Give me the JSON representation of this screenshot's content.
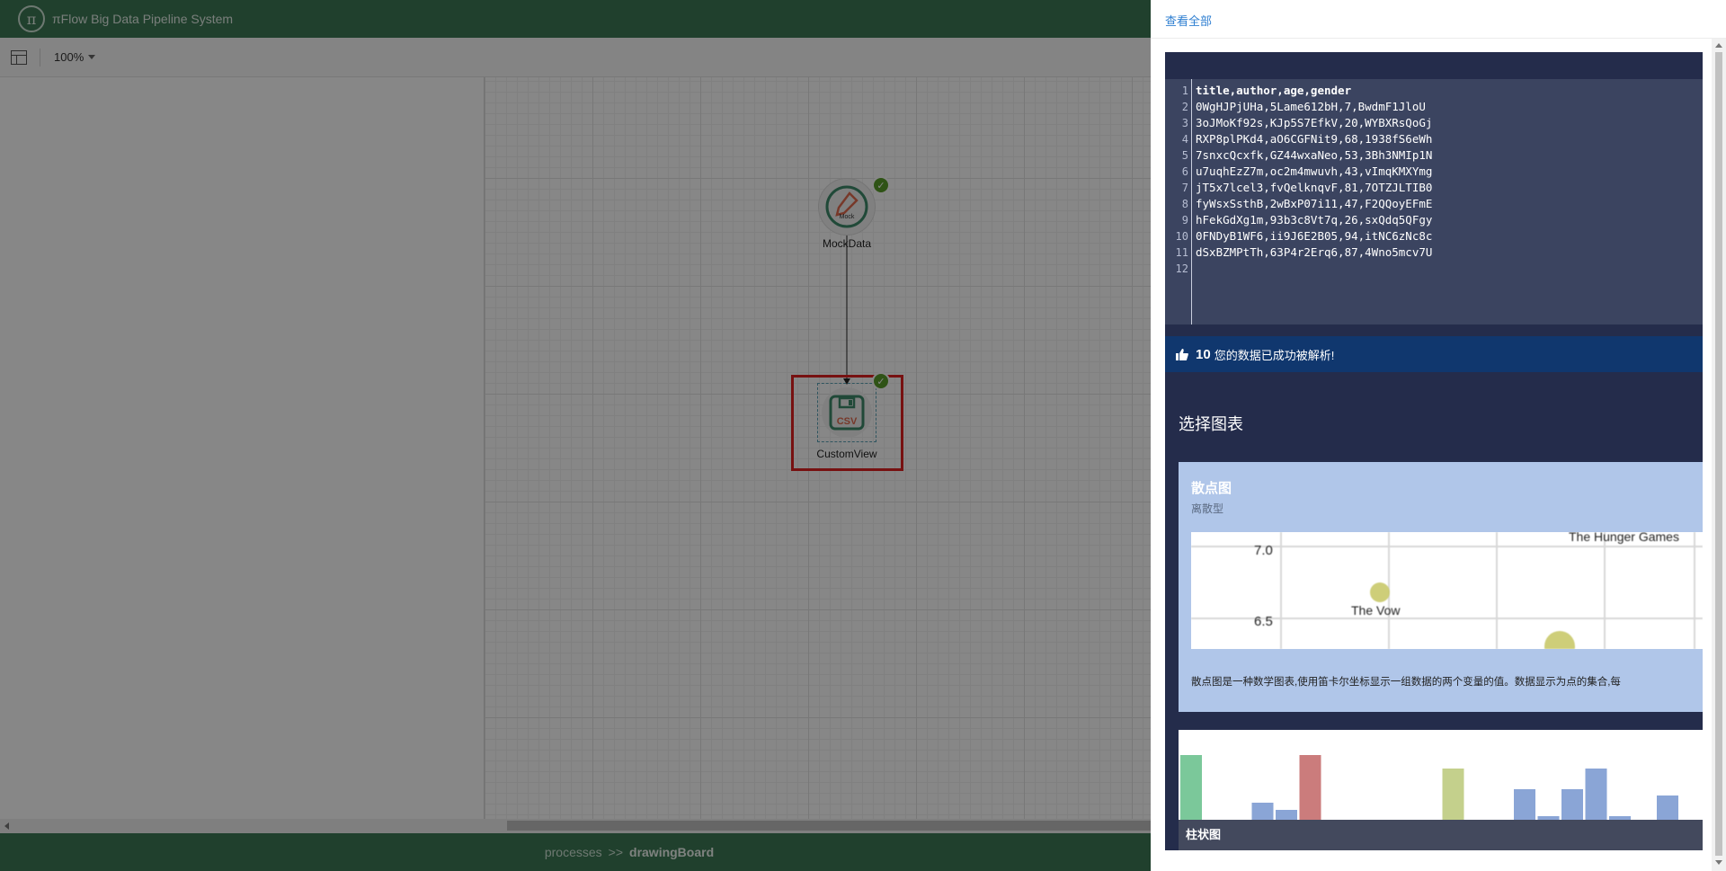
{
  "app": {
    "logo_glyph": "π",
    "title": "πFlow Big Data Pipeline System"
  },
  "toolbar": {
    "zoom": "100%"
  },
  "canvas": {
    "nodes": [
      {
        "id": "mockdata",
        "label": "MockData",
        "icon": "mock-pencil-icon",
        "icon_text": "Mock",
        "status": "success"
      },
      {
        "id": "customview",
        "label": "CustomView",
        "icon": "csv-save-icon",
        "icon_text": "CSV",
        "status": "success",
        "selected": true
      }
    ]
  },
  "footer": {
    "crumb_root": "processes",
    "crumb_sep": ">>",
    "crumb_current": "drawingBoard"
  },
  "drawer": {
    "view_all": "查看全部",
    "editor": {
      "lines": [
        "title,author,age,gender",
        "0WgHJPjUHa,5Lame612bH,7,BwdmF1JloU",
        "3oJMoKf92s,KJp5S7EfkV,20,WYBXRsQoGj",
        "RXP8plPKd4,aO6CGFNit9,68,1938fS6eWh",
        "7snxcQcxfk,GZ44wxaNeo,53,3Bh3NMIp1N",
        "u7uqhEzZ7m,oc2m4mwuvh,43,vImqKMXYmg",
        "jT5x7lcel3,fvQelknqvF,81,7OTZJLTIB0",
        "fyWsxSsthB,2wBxP07i11,47,F2QQoyEFmE",
        "hFekGdXg1m,93b3c8Vt7q,26,sxQdq5QFgy",
        "0FNDyB1WF6,ii9J6E2B05,94,itNC6zNc8c",
        "dSxBZMPtTh,63P4r2Erq6,87,4Wno5mcv7U",
        ""
      ]
    },
    "notice": {
      "count": "10",
      "message": "您的数据已成功被解析!"
    },
    "choose_chart_title": "选择图表",
    "charts": {
      "scatter": {
        "title": "散点图",
        "subtitle": "离散型",
        "preview_labels": {
          "y1": "7.0",
          "y2": "6.5",
          "point1": "The Vow",
          "point2": "The Hunger Games"
        },
        "description": "散点图是一种数学图表,使用笛卡尔坐标显示一组数据的两个变量的值。数据显示为点的集合,每"
      },
      "bar": {
        "title": "柱状图",
        "bars": [
          {
            "value": 72,
            "color": "#7bc89a"
          },
          {
            "value": 0,
            "color": "#8aa5d6"
          },
          {
            "value": 0,
            "color": "#8aa5d6"
          },
          {
            "value": 19,
            "color": "#8aa5d6"
          },
          {
            "value": 11,
            "color": "#8aa5d6"
          },
          {
            "value": 72,
            "color": "#cb7c7c"
          },
          {
            "value": 0,
            "color": "#8aa5d6"
          },
          {
            "value": 0,
            "color": "#8aa5d6"
          },
          {
            "value": 0,
            "color": "#8aa5d6"
          },
          {
            "value": 0,
            "color": "#8aa5d6"
          },
          {
            "value": 0,
            "color": "#8aa5d6"
          },
          {
            "value": 57,
            "color": "#c4d08c"
          },
          {
            "value": 0,
            "color": "#8aa5d6"
          },
          {
            "value": 0,
            "color": "#8aa5d6"
          },
          {
            "value": 34,
            "color": "#8aa5d6"
          },
          {
            "value": 4,
            "color": "#8aa5d6"
          },
          {
            "value": 34,
            "color": "#8aa5d6"
          },
          {
            "value": 57,
            "color": "#8aa5d6"
          },
          {
            "value": 4,
            "color": "#8aa5d6"
          },
          {
            "value": 0,
            "color": "#8aa5d6"
          },
          {
            "value": 27,
            "color": "#8aa5d6"
          }
        ]
      }
    }
  },
  "colors": {
    "header_green": "#3d7a55",
    "drawer_dark": "#242c4b",
    "notice_blue": "#10376e",
    "link_blue": "#2f7fd1",
    "success_green": "#5a9e2a",
    "selection_red": "#e02020"
  }
}
